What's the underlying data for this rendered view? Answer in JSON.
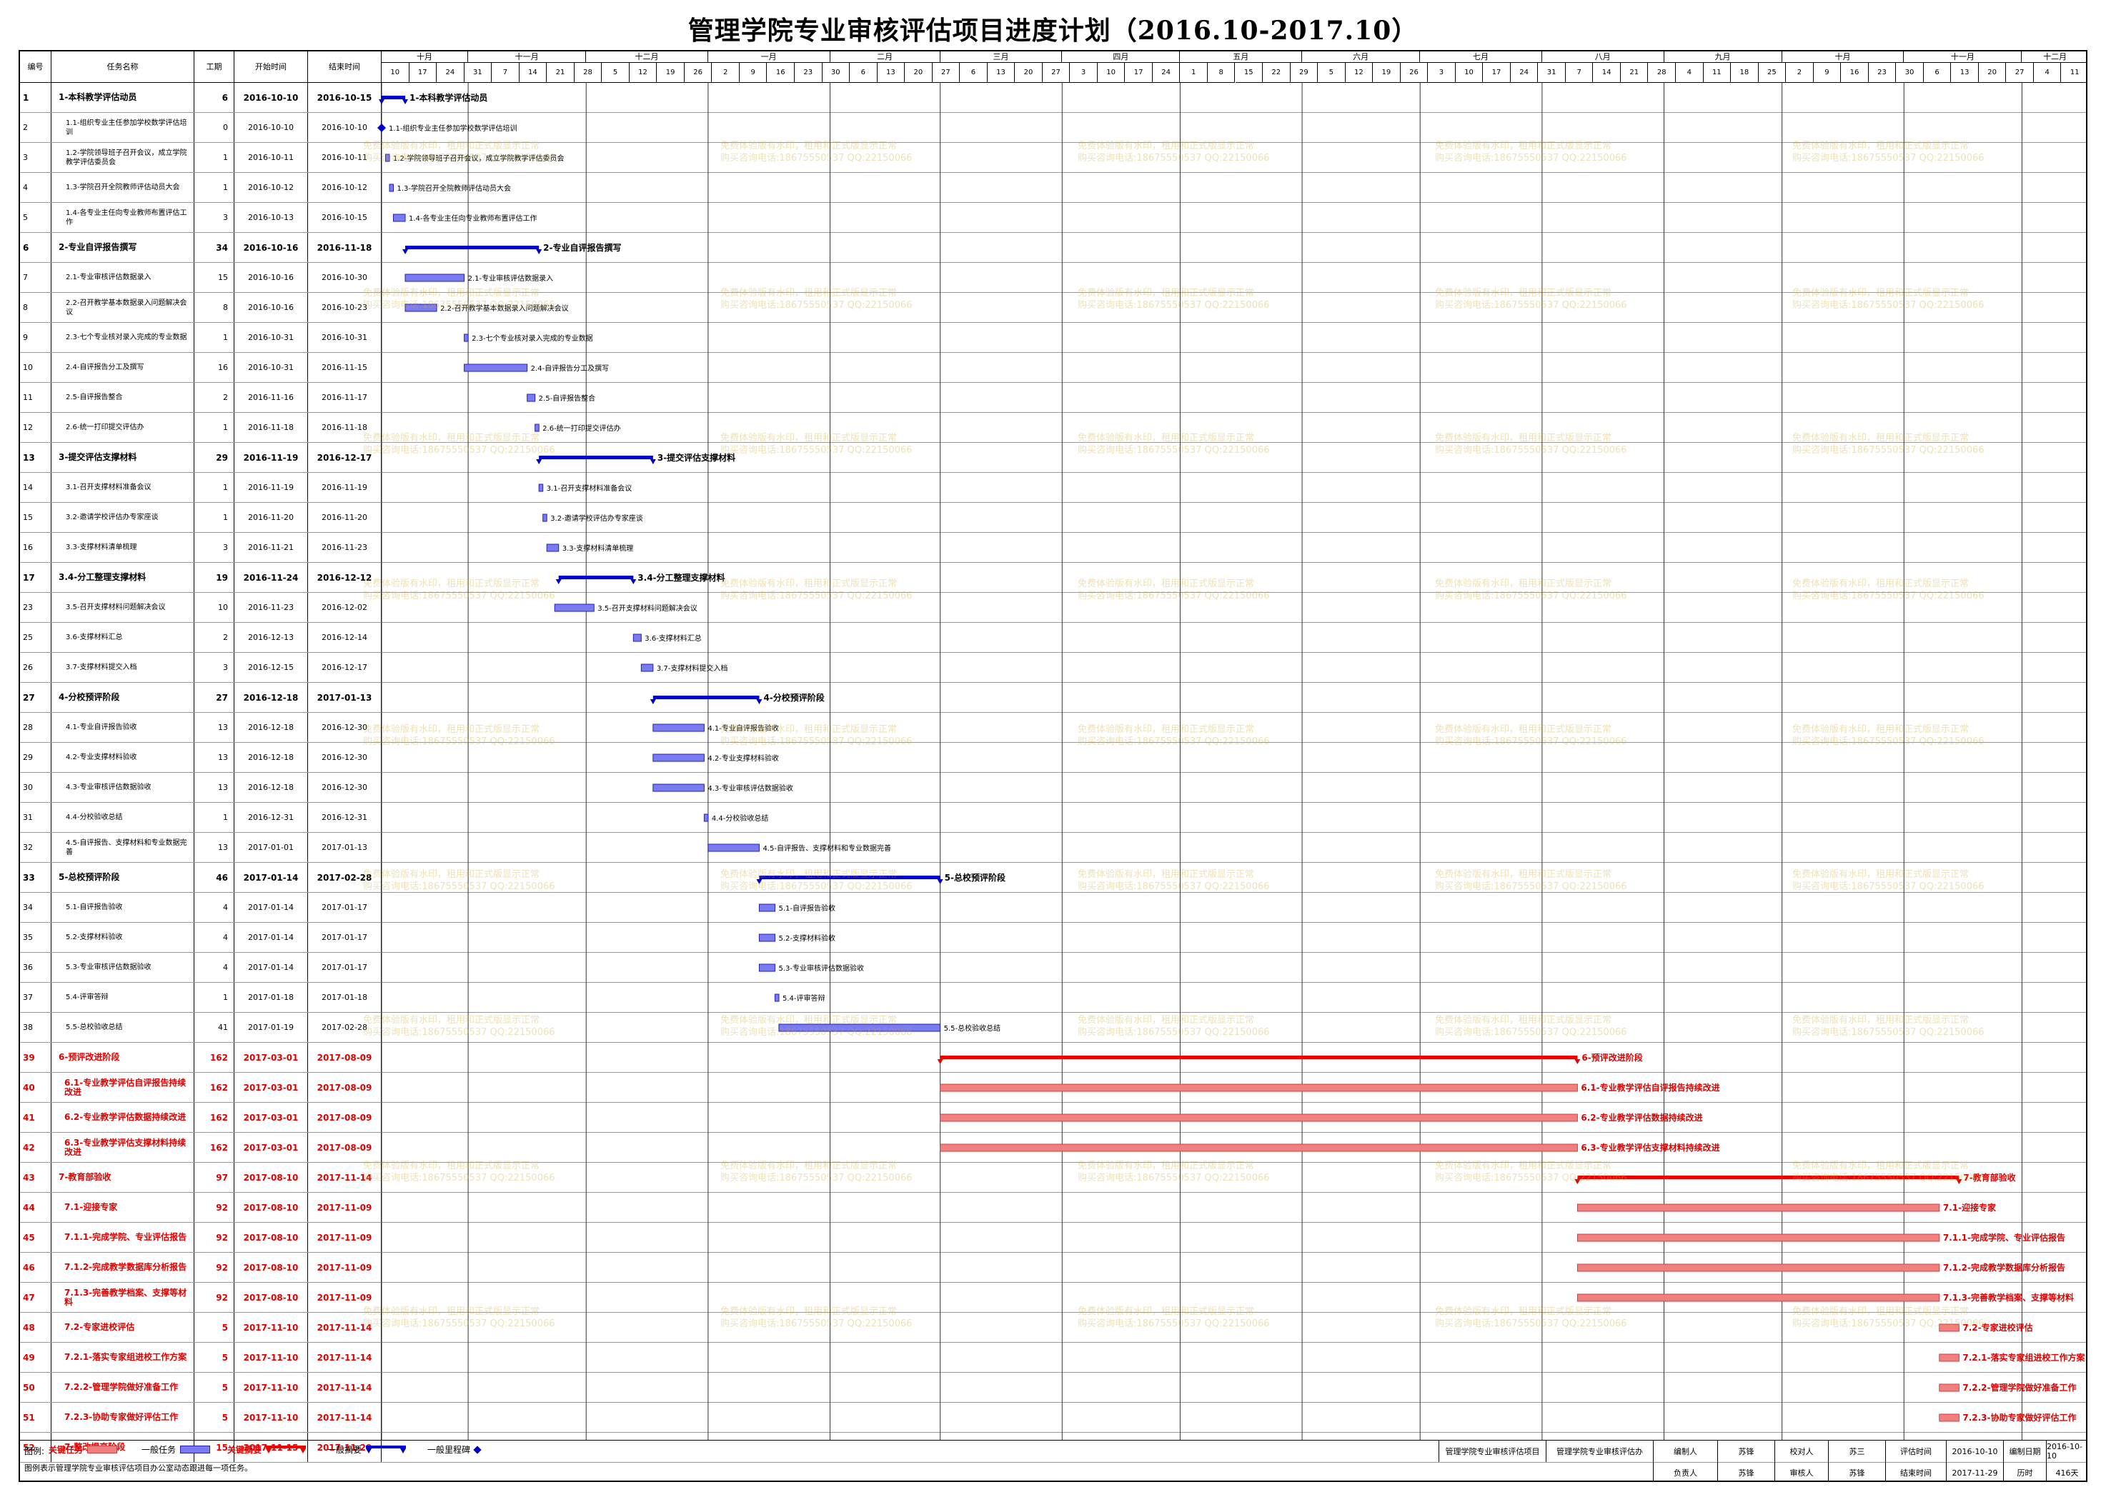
{
  "title": "管理学院专业审核评估项目进度计划（2016.10-2017.10）",
  "header": {
    "cols": [
      "编号",
      "任务名称",
      "工期",
      "开始时间",
      "结束时间"
    ],
    "months": [
      "十月",
      "十一月",
      "十二月",
      "一月",
      "二月",
      "三月",
      "四月",
      "五月",
      "六月",
      "七月",
      "八月",
      "九月",
      "十月",
      "十一月",
      "十二月"
    ],
    "weeks": [
      "10",
      "17",
      "24",
      "31",
      "7",
      "14",
      "21",
      "28",
      "5",
      "12",
      "19",
      "26",
      "2",
      "9",
      "16",
      "23",
      "30",
      "6",
      "13",
      "20",
      "27",
      "6",
      "13",
      "20",
      "27",
      "3",
      "10",
      "17",
      "24",
      "1",
      "8",
      "15",
      "22",
      "29",
      "5",
      "12",
      "19",
      "26",
      "3",
      "10",
      "17",
      "24",
      "31",
      "7",
      "14",
      "21",
      "28",
      "4",
      "11",
      "18",
      "25",
      "2",
      "9",
      "16",
      "23",
      "30",
      "6",
      "13",
      "20",
      "27",
      "4",
      "11"
    ]
  },
  "chart_data": {
    "type": "gantt",
    "title": "管理学院专业审核评估项目进度计划（2016.10-2017.10）",
    "x_start": "2016-10-10",
    "tasks": [
      {
        "id": "1",
        "name": "1-本科教学评估动员",
        "dur": "6",
        "start": "2016-10-10",
        "end": "2016-10-15",
        "kind": "summary"
      },
      {
        "id": "2",
        "name": "1.1-组织专业主任参加学校数学评估培训",
        "dur": "0",
        "start": "2016-10-10",
        "end": "2016-10-10",
        "kind": "milestone",
        "label": "1.1-组织专业主任参加学校数学评估培训"
      },
      {
        "id": "3",
        "name": "1.2-学院领导班子召开会议，成立学院教学评估委员会",
        "dur": "1",
        "start": "2016-10-11",
        "end": "2016-10-11",
        "kind": "task",
        "label": "1.2-学院领导班子召开会议，成立学院教学评估委员会"
      },
      {
        "id": "4",
        "name": "1.3-学院召开全院教师评估动员大会",
        "dur": "1",
        "start": "2016-10-12",
        "end": "2016-10-12",
        "kind": "task",
        "label": "1.3-学院召开全院教师评估动员大会"
      },
      {
        "id": "5",
        "name": "1.4-各专业主任向专业教师布置评估工作",
        "dur": "3",
        "start": "2016-10-13",
        "end": "2016-10-15",
        "kind": "task",
        "label": "1.4-各专业主任向专业教师布置评估工作"
      },
      {
        "id": "6",
        "name": "2-专业自评报告撰写",
        "dur": "34",
        "start": "2016-10-16",
        "end": "2016-11-18",
        "kind": "summary"
      },
      {
        "id": "7",
        "name": "2.1-专业审核评估数据录入",
        "dur": "15",
        "start": "2016-10-16",
        "end": "2016-10-30",
        "kind": "task",
        "label": "2.1-专业审核评估数据录入"
      },
      {
        "id": "8",
        "name": "2.2-召开教学基本数据录入问题解决会议",
        "dur": "8",
        "start": "2016-10-16",
        "end": "2016-10-23",
        "kind": "task",
        "label": "2.2-召开教学基本数据录入问题解决会议"
      },
      {
        "id": "9",
        "name": "2.3-七个专业核对录入完成的专业数据",
        "dur": "1",
        "start": "2016-10-31",
        "end": "2016-10-31",
        "kind": "task",
        "label": "2.3-七个专业核对录入完成的专业数据"
      },
      {
        "id": "10",
        "name": "2.4-自评报告分工及撰写",
        "dur": "16",
        "start": "2016-10-31",
        "end": "2016-11-15",
        "kind": "task",
        "label": "2.4-自评报告分工及撰写"
      },
      {
        "id": "11",
        "name": "2.5-自评报告整合",
        "dur": "2",
        "start": "2016-11-16",
        "end": "2016-11-17",
        "kind": "task",
        "label": "2.5-自评报告整合"
      },
      {
        "id": "12",
        "name": "2.6-统一打印提交评估办",
        "dur": "1",
        "start": "2016-11-18",
        "end": "2016-11-18",
        "kind": "task",
        "label": "2.6-统一打印提交评估办"
      },
      {
        "id": "13",
        "name": "3-提交评估支撑材料",
        "dur": "29",
        "start": "2016-11-19",
        "end": "2016-12-17",
        "kind": "summary"
      },
      {
        "id": "14",
        "name": "3.1-召开支撑材料准备会议",
        "dur": "1",
        "start": "2016-11-19",
        "end": "2016-11-19",
        "kind": "task",
        "label": "3.1-召开支撑材料准备会议"
      },
      {
        "id": "15",
        "name": "3.2-邀请学校评估办专家座谈",
        "dur": "1",
        "start": "2016-11-20",
        "end": "2016-11-20",
        "kind": "task",
        "label": "3.2-邀请学校评估办专家座谈"
      },
      {
        "id": "16",
        "name": "3.3-支撑材料清单梳理",
        "dur": "3",
        "start": "2016-11-21",
        "end": "2016-11-23",
        "kind": "task",
        "label": "3.3-支撑材料清单梳理"
      },
      {
        "id": "17",
        "name": "3.4-分工整理支撑材料",
        "dur": "19",
        "start": "2016-11-24",
        "end": "2016-12-12",
        "kind": "summary",
        "label": "3.4-分工整理支撑材料"
      },
      {
        "id": "23",
        "name": "3.5-召开支撑材料问题解决会议",
        "dur": "10",
        "start": "2016-11-23",
        "end": "2016-12-02",
        "kind": "task",
        "label": "3.5-召开支撑材料问题解决会议"
      },
      {
        "id": "25",
        "name": "3.6-支撑材料汇总",
        "dur": "2",
        "start": "2016-12-13",
        "end": "2016-12-14",
        "kind": "task",
        "label": "3.6-支撑材料汇总"
      },
      {
        "id": "26",
        "name": "3.7-支撑材料提交入档",
        "dur": "3",
        "start": "2016-12-15",
        "end": "2016-12-17",
        "kind": "task",
        "label": "3.7-支撑材料提交入档"
      },
      {
        "id": "27",
        "name": "4-分校预评阶段",
        "dur": "27",
        "start": "2016-12-18",
        "end": "2017-01-13",
        "kind": "summary"
      },
      {
        "id": "28",
        "name": "4.1-专业自评报告验收",
        "dur": "13",
        "start": "2016-12-18",
        "end": "2016-12-30",
        "kind": "task",
        "label": "4.1-专业自评报告验收"
      },
      {
        "id": "29",
        "name": "4.2-专业支撑材料验收",
        "dur": "13",
        "start": "2016-12-18",
        "end": "2016-12-30",
        "kind": "task",
        "label": "4.2-专业支撑材料验收"
      },
      {
        "id": "30",
        "name": "4.3-专业审核评估数据验收",
        "dur": "13",
        "start": "2016-12-18",
        "end": "2016-12-30",
        "kind": "task",
        "label": "4.3-专业审核评估数据验收"
      },
      {
        "id": "31",
        "name": "4.4-分校验收总结",
        "dur": "1",
        "start": "2016-12-31",
        "end": "2016-12-31",
        "kind": "task",
        "label": "4.4-分校验收总结"
      },
      {
        "id": "32",
        "name": "4.5-自评报告、支撑材料和专业数据完善",
        "dur": "13",
        "start": "2017-01-01",
        "end": "2017-01-13",
        "kind": "task",
        "label": "4.5-自评报告、支撑材料和专业数据完善"
      },
      {
        "id": "33",
        "name": "5-总校预评阶段",
        "dur": "46",
        "start": "2017-01-14",
        "end": "2017-02-28",
        "kind": "summary"
      },
      {
        "id": "34",
        "name": "5.1-自评报告验收",
        "dur": "4",
        "start": "2017-01-14",
        "end": "2017-01-17",
        "kind": "task",
        "label": "5.1-自评报告验收"
      },
      {
        "id": "35",
        "name": "5.2-支撑材料验收",
        "dur": "4",
        "start": "2017-01-14",
        "end": "2017-01-17",
        "kind": "task",
        "label": "5.2-支撑材料验收"
      },
      {
        "id": "36",
        "name": "5.3-专业审核评估数据验收",
        "dur": "4",
        "start": "2017-01-14",
        "end": "2017-01-17",
        "kind": "task",
        "label": "5.3-专业审核评估数据验收"
      },
      {
        "id": "37",
        "name": "5.4-评审答辩",
        "dur": "1",
        "start": "2017-01-18",
        "end": "2017-01-18",
        "kind": "task",
        "label": "5.4-评审答辩"
      },
      {
        "id": "38",
        "name": "5.5-总校验收总结",
        "dur": "41",
        "start": "2017-01-19",
        "end": "2017-02-28",
        "kind": "task",
        "label": "5.5-总校验收总结"
      },
      {
        "id": "39",
        "name": "6-预评改进阶段",
        "dur": "162",
        "start": "2017-03-01",
        "end": "2017-08-09",
        "kind": "summary",
        "critical": true
      },
      {
        "id": "40",
        "name": "6.1-专业教学评估自评报告持续改进",
        "dur": "162",
        "start": "2017-03-01",
        "end": "2017-08-09",
        "kind": "task",
        "critical": true,
        "label": "6.1-专业教学评估自评报告持续改进"
      },
      {
        "id": "41",
        "name": "6.2-专业教学评估数据持续改进",
        "dur": "162",
        "start": "2017-03-01",
        "end": "2017-08-09",
        "kind": "task",
        "critical": true,
        "label": "6.2-专业教学评估数据持续改进"
      },
      {
        "id": "42",
        "name": "6.3-专业教学评估支撑材料持续改进",
        "dur": "162",
        "start": "2017-03-01",
        "end": "2017-08-09",
        "kind": "task",
        "critical": true,
        "label": "6.3-专业教学评估支撑材料持续改进"
      },
      {
        "id": "43",
        "name": "7-教育部验收",
        "dur": "97",
        "start": "2017-08-10",
        "end": "2017-11-14",
        "kind": "summary",
        "critical": true
      },
      {
        "id": "44",
        "name": "7.1-迎接专家",
        "dur": "92",
        "start": "2017-08-10",
        "end": "2017-11-09",
        "kind": "task",
        "critical": true,
        "label": "7.1-迎接专家"
      },
      {
        "id": "45",
        "name": "7.1.1-完成学院、专业评估报告",
        "dur": "92",
        "start": "2017-08-10",
        "end": "2017-11-09",
        "kind": "task",
        "critical": true,
        "label": "7.1.1-完成学院、专业评估报告"
      },
      {
        "id": "46",
        "name": "7.1.2-完成教学数据库分析报告",
        "dur": "92",
        "start": "2017-08-10",
        "end": "2017-11-09",
        "kind": "task",
        "critical": true,
        "label": "7.1.2-完成教学数据库分析报告"
      },
      {
        "id": "47",
        "name": "7.1.3-完善教学档案、支撑等材料",
        "dur": "92",
        "start": "2017-08-10",
        "end": "2017-11-09",
        "kind": "task",
        "critical": true,
        "label": "7.1.3-完善教学档案、支撑等材料"
      },
      {
        "id": "48",
        "name": "7.2-专家进校评估",
        "dur": "5",
        "start": "2017-11-10",
        "end": "2017-11-14",
        "kind": "task",
        "critical": true,
        "label": "7.2-专家进校评估"
      },
      {
        "id": "49",
        "name": "7.2.1-落实专家组进校工作方案",
        "dur": "5",
        "start": "2017-11-10",
        "end": "2017-11-14",
        "kind": "task",
        "critical": true,
        "label": "7.2.1-落实专家组进校工作方案"
      },
      {
        "id": "50",
        "name": "7.2.2-管理学院做好准备工作",
        "dur": "5",
        "start": "2017-11-10",
        "end": "2017-11-14",
        "kind": "task",
        "critical": true,
        "label": "7.2.2-管理学院做好准备工作"
      },
      {
        "id": "51",
        "name": "7.2.3-协助专家做好评估工作",
        "dur": "5",
        "start": "2017-11-10",
        "end": "2017-11-14",
        "kind": "task",
        "critical": true,
        "label": "7.2.3-协助专家做好评估工作"
      },
      {
        "id": "52",
        "name": "7-整改提高阶段",
        "dur": "15",
        "start": "2017-11-15",
        "end": "2017-11-29",
        "kind": "task",
        "critical": true,
        "label": "7-整改提高阶段"
      }
    ]
  },
  "watermark": {
    "line1": "免费体验版有水印，租用和正式版显示正常",
    "line2": "购买咨询电话:18675550537 QQ:22150066"
  },
  "legend": {
    "title": "图例:",
    "items": [
      "关键任务",
      "一般任务",
      "关键摘要",
      "一般摘要",
      "一般里程碑"
    ],
    "note": "图例表示管理学院专业审核评估项目办公室动态跟进每一项任务。"
  },
  "footer": {
    "project1": "管理学院专业审核评估项目",
    "project2": "管理学院专业审核评估办",
    "labels": [
      "编制人",
      "负责人",
      "校对人",
      "审核人",
      "评估时间",
      "结束时间",
      "编制日期",
      "历时"
    ],
    "values": [
      "苏锋",
      "苏锋",
      "苏三",
      "苏锋",
      "2016-10-10",
      "2017-11-29",
      "2016-10-10",
      "416天"
    ]
  },
  "colors": {
    "normal_bar": "#7b7bf0",
    "normal_border": "#2020c0",
    "normal_summary": "#0000cc",
    "critical_bar": "#f08080",
    "critical_border": "#d04040",
    "critical_summary": "#ee0000"
  }
}
